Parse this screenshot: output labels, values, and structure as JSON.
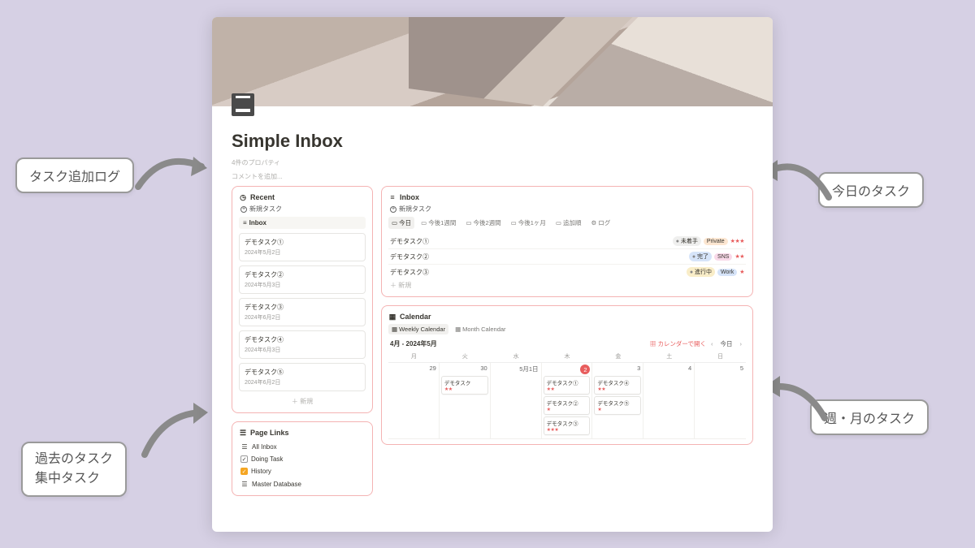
{
  "page": {
    "title": "Simple Inbox",
    "meta1": "4件のプロパティ",
    "meta2": "コメントを追加...",
    "icon_name": "archive-box-icon"
  },
  "recent": {
    "title": "Recent",
    "new_task": "新規タスク",
    "group": "Inbox",
    "add": "＋ 新規",
    "cards": [
      {
        "title": "デモタスク①",
        "date": "2024年5月2日"
      },
      {
        "title": "デモタスク②",
        "date": "2024年5月3日"
      },
      {
        "title": "デモタスク③",
        "date": "2024年6月2日"
      },
      {
        "title": "デモタスク④",
        "date": "2024年6月3日"
      },
      {
        "title": "デモタスク⑤",
        "date": "2024年6月2日"
      }
    ]
  },
  "page_links": {
    "title": "Page Links",
    "items": [
      {
        "icon": "inbox-icon",
        "label": "All Inbox",
        "checked": false
      },
      {
        "icon": "checkbox-icon",
        "label": "Doing Task",
        "checked": true
      },
      {
        "icon": "checkbox-icon",
        "label": "History",
        "checked": true,
        "orange": true
      },
      {
        "icon": "database-icon",
        "label": "Master Database",
        "checked": false
      }
    ]
  },
  "inbox": {
    "title": "Inbox",
    "new_task": "新規タスク",
    "tabs": [
      "今日",
      "今後1週間",
      "今後2週間",
      "今後1ヶ月",
      "追加順",
      "ログ"
    ],
    "active_tab": 0,
    "rows": [
      {
        "title": "デモタスク①",
        "status": "未着手",
        "status_color": "gray",
        "cat": "Private",
        "cat_color": "orange",
        "stars": "★★★"
      },
      {
        "title": "デモタスク②",
        "status": "完了",
        "status_color": "blue",
        "cat": "SNS",
        "cat_color": "pink",
        "stars": "★★"
      },
      {
        "title": "デモタスク③",
        "status": "進行中",
        "status_color": "yellow",
        "cat": "Work",
        "cat_color": "blue",
        "stars": "★"
      }
    ],
    "add": "＋ 新規"
  },
  "calendar": {
    "title": "Calendar",
    "tabs": [
      "Weekly Calendar",
      "Month Calendar"
    ],
    "active_tab": 0,
    "range": "4月 - 2024年5月",
    "open_label": "カレンダーで開く",
    "nav_prev": "‹",
    "today_btn": "今日",
    "nav_next": "›",
    "day_headers": [
      "月",
      "火",
      "水",
      "木",
      "金",
      "土",
      "日"
    ],
    "days": [
      {
        "num": "29"
      },
      {
        "num": "30",
        "events": [
          {
            "t": "デモタスク",
            "s": "★★"
          }
        ]
      },
      {
        "num": "5月1日"
      },
      {
        "num": "2",
        "today": true,
        "events": [
          {
            "t": "デモタスク①",
            "s": "★★"
          },
          {
            "t": "デモタスク②",
            "s": "★"
          },
          {
            "t": "デモタスク③",
            "s": "★★★"
          }
        ]
      },
      {
        "num": "3",
        "events": [
          {
            "t": "デモタスク④",
            "s": "★★"
          },
          {
            "t": "デモタスク⑤",
            "s": "★"
          }
        ]
      },
      {
        "num": "4"
      },
      {
        "num": "5"
      }
    ]
  },
  "callouts": {
    "c1": "タスク追加ログ",
    "c2": "過去のタスク\n集中タスク",
    "c3": "今日のタスク",
    "c4": "週・月のタスク"
  }
}
